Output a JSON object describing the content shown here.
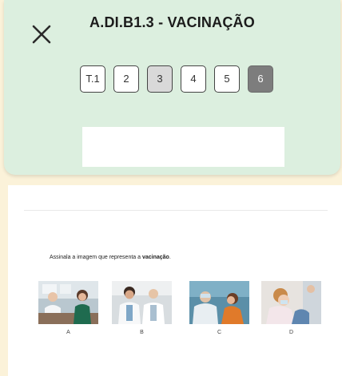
{
  "header": {
    "title": "A.DI.B1.3 - VACINAÇÃO",
    "tabs": [
      {
        "label": "T.1",
        "state": "normal"
      },
      {
        "label": "2",
        "state": "normal"
      },
      {
        "label": "3",
        "state": "current"
      },
      {
        "label": "4",
        "state": "normal"
      },
      {
        "label": "5",
        "state": "normal"
      },
      {
        "label": "6",
        "state": "locked"
      }
    ],
    "answer_value": ""
  },
  "question": {
    "text_before": "Assinala a imagem que representa a ",
    "text_bold": "vacinação",
    "text_after": "."
  },
  "options": [
    {
      "label": "A",
      "icon": "doctor-patient-consult-image"
    },
    {
      "label": "B",
      "icon": "doctors-colleagues-image"
    },
    {
      "label": "C",
      "icon": "child-vaccination-image"
    },
    {
      "label": "D",
      "icon": "child-dental-checkup-image"
    }
  ],
  "colors": {
    "background": "#fbf2d9",
    "header": "#dcefdf",
    "locked_tab": "#7d7d7d",
    "current_tab": "#d9d9d9"
  }
}
